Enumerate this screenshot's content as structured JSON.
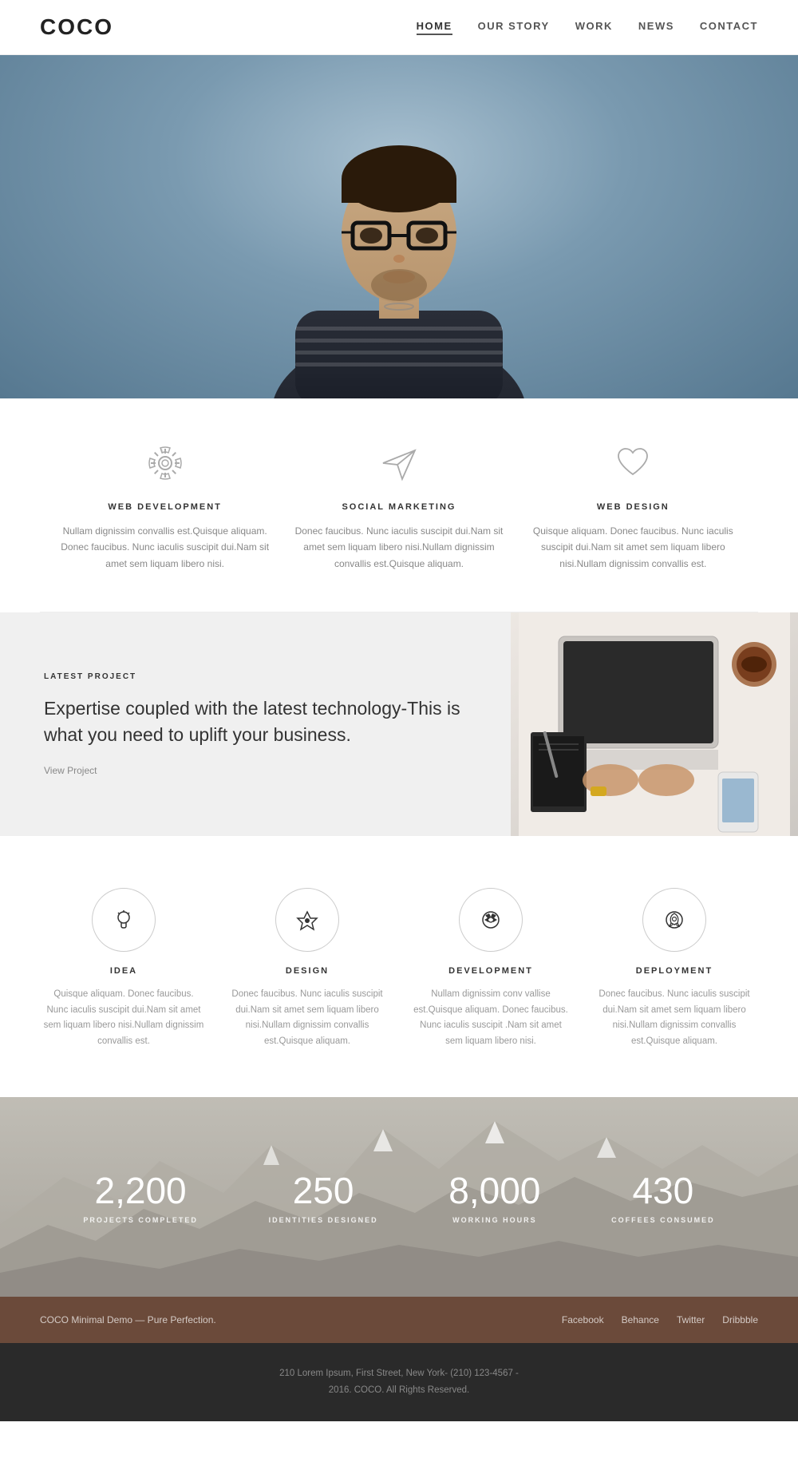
{
  "header": {
    "logo": "COCO",
    "nav": [
      {
        "label": "HOME",
        "active": true
      },
      {
        "label": "OUR STORY",
        "active": false
      },
      {
        "label": "WORK",
        "active": false
      },
      {
        "label": "NEWS",
        "active": false
      },
      {
        "label": "CONTACT",
        "active": false
      }
    ]
  },
  "services": {
    "items": [
      {
        "title": "WEB DEVELOPMENT",
        "desc": "Nullam dignissim convallis est.Quisque aliquam. Donec faucibus. Nunc iaculis suscipit dui.Nam sit amet sem liquam libero nisi."
      },
      {
        "title": "SOCIAL MARKETING",
        "desc": "Donec faucibus. Nunc iaculis suscipit dui.Nam sit amet sem liquam libero nisi.Nullam dignissim convallis est.Quisque aliquam."
      },
      {
        "title": "WEB DESIGN",
        "desc": "Quisque aliquam. Donec faucibus. Nunc iaculis suscipit dui.Nam sit amet sem liquam libero nisi.Nullam dignissim convallis est."
      }
    ]
  },
  "latest_project": {
    "label": "LATEST PROJECT",
    "heading": "Expertise coupled with the latest technology-This is what you need to uplift your business.",
    "link_text": "View Project"
  },
  "process": {
    "items": [
      {
        "title": "IDEA",
        "desc": "Quisque aliquam. Donec faucibus. Nunc iaculis suscipit dui.Nam sit amet sem liquam libero nisi.Nullam dignissim convallis est."
      },
      {
        "title": "DESIGN",
        "desc": "Donec faucibus. Nunc iaculis suscipit dui.Nam sit amet sem liquam libero nisi.Nullam dignissim convallis est.Quisque aliquam."
      },
      {
        "title": "DEVELOPMENT",
        "desc": "Nullam dignissim conv vallise est.Quisque aliquam. Donec faucibus. Nunc iaculis suscipit .Nam sit amet sem liquam libero nisi."
      },
      {
        "title": "DEPLOYMENT",
        "desc": "Donec faucibus. Nunc iaculis suscipit dui.Nam sit amet sem liquam libero nisi.Nullam dignissim convallis est.Quisque aliquam."
      }
    ]
  },
  "stats": {
    "items": [
      {
        "number": "2,200",
        "label": "PROJECTS COMPLETED"
      },
      {
        "number": "250",
        "label": "IDENTITIES DESIGNED"
      },
      {
        "number": "8,000",
        "label": "WORKING HOURS"
      },
      {
        "number": "430",
        "label": "COFFEES CONSUMED"
      }
    ]
  },
  "footer": {
    "copy": "COCO Minimal Demo — Pure Perfection.",
    "links": [
      "Facebook",
      "Behance",
      "Twitter",
      "Dribbble"
    ],
    "address_line1": "210 Lorem Ipsum, First Street, New York- (210) 123-4567 -",
    "address_line2": "2016. COCO. All Rights Reserved."
  }
}
